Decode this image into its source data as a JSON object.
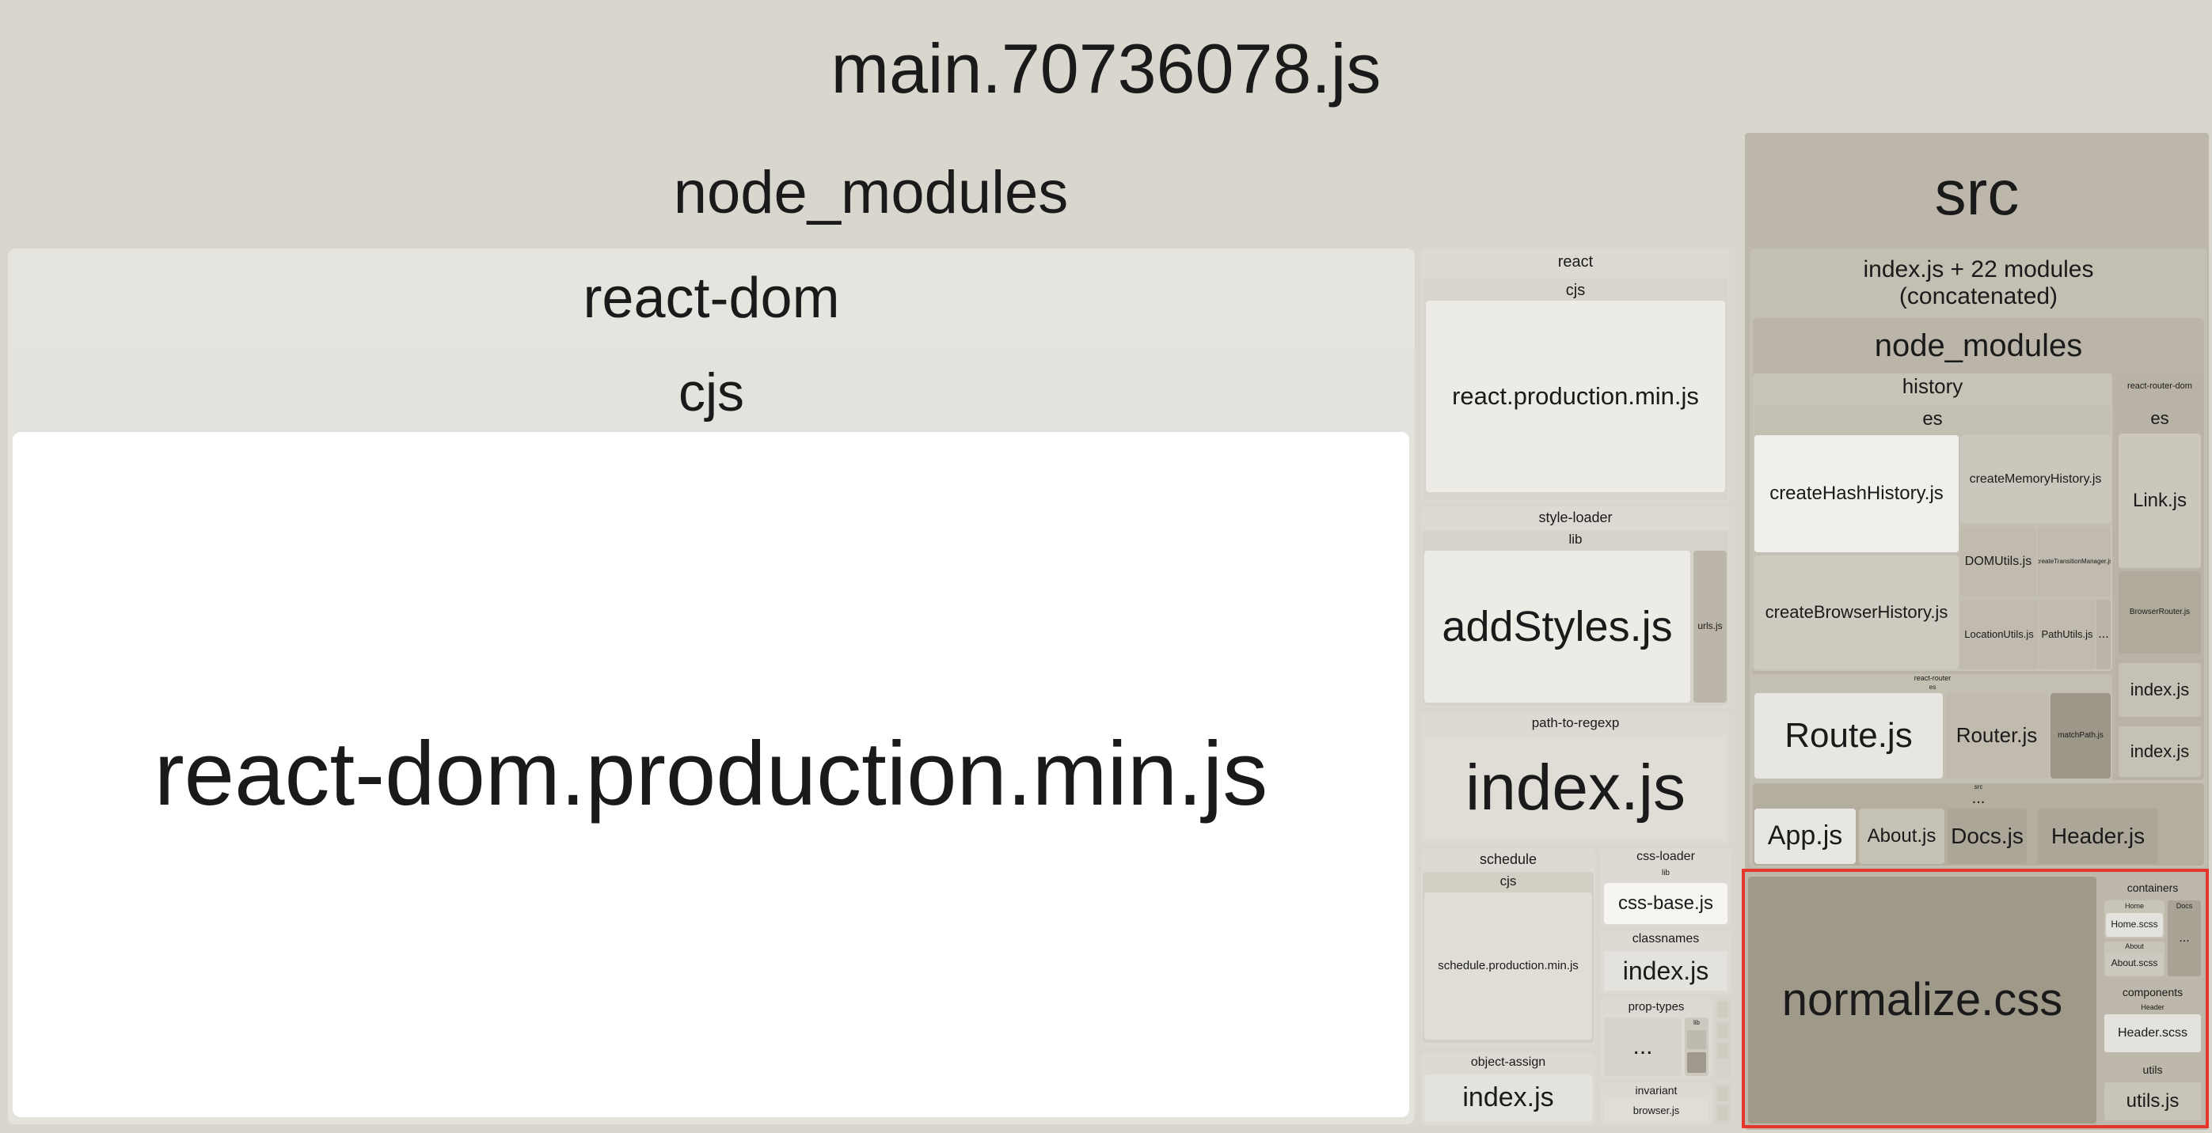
{
  "root": {
    "label": "main.70736078.js"
  },
  "node_modules": {
    "label": "node_modules"
  },
  "react_dom": {
    "label": "react-dom",
    "cjs": "cjs",
    "file": "react-dom.production.min.js"
  },
  "react": {
    "label": "react",
    "cjs": "cjs",
    "file": "react.production.min.js"
  },
  "style_loader": {
    "label": "style-loader",
    "lib": "lib",
    "add_styles": "addStyles.js",
    "urls": "urls.js"
  },
  "path_to_regexp": {
    "label": "path-to-regexp",
    "index": "index.js"
  },
  "schedule": {
    "label": "schedule",
    "cjs": "cjs",
    "file": "schedule.production.min.js"
  },
  "css_loader": {
    "label": "css-loader",
    "lib": "lib",
    "file": "css-base.js"
  },
  "classnames": {
    "label": "classnames",
    "index": "index.js"
  },
  "prop_types": {
    "label": "prop-types",
    "ellipsis": "...",
    "lib": "lib"
  },
  "object_assign": {
    "label": "object-assign",
    "index": "index.js"
  },
  "invariant": {
    "label": "invariant",
    "file": "browser.js"
  },
  "src": {
    "label": "src",
    "index_concat": {
      "line1": "index.js + 22 modules",
      "line2": "(concatenated)"
    },
    "node_modules": "node_modules",
    "history": {
      "label": "history",
      "es": "es",
      "create_hash": "createHashHistory.js",
      "create_memory": "createMemoryHistory.js",
      "dom_utils": "DOMUtils.js",
      "create_transition": "createTransitionManager.js",
      "create_browser": "createBrowserHistory.js",
      "location_utils": "LocationUtils.js",
      "path_utils": "PathUtils.js",
      "more": "..."
    },
    "react_router_dom": {
      "label": "react-router-dom",
      "es": "es",
      "link": "Link.js",
      "browser_router": "BrowserRouter.js",
      "index1": "index.js",
      "index2": "index.js"
    },
    "react_router": {
      "label": "react-router",
      "es": "es",
      "route": "Route.js",
      "router": "Router.js",
      "match_path": "matchPath.js"
    },
    "src_inner": {
      "label": "src",
      "more": "...",
      "app": "App.js",
      "about": "About.js",
      "docs": "Docs.js",
      "header": "Header.js"
    },
    "normalize": "normalize.css",
    "containers": {
      "label": "containers",
      "home": "Home",
      "docs": "Docs",
      "home_scss": "Home.scss",
      "about": "About",
      "about_scss": "About.scss",
      "more": "..."
    },
    "components": {
      "label": "components",
      "header": "Header",
      "header_scss": "Header.scss"
    },
    "utils": {
      "label": "utils",
      "file": "utils.js"
    }
  }
}
